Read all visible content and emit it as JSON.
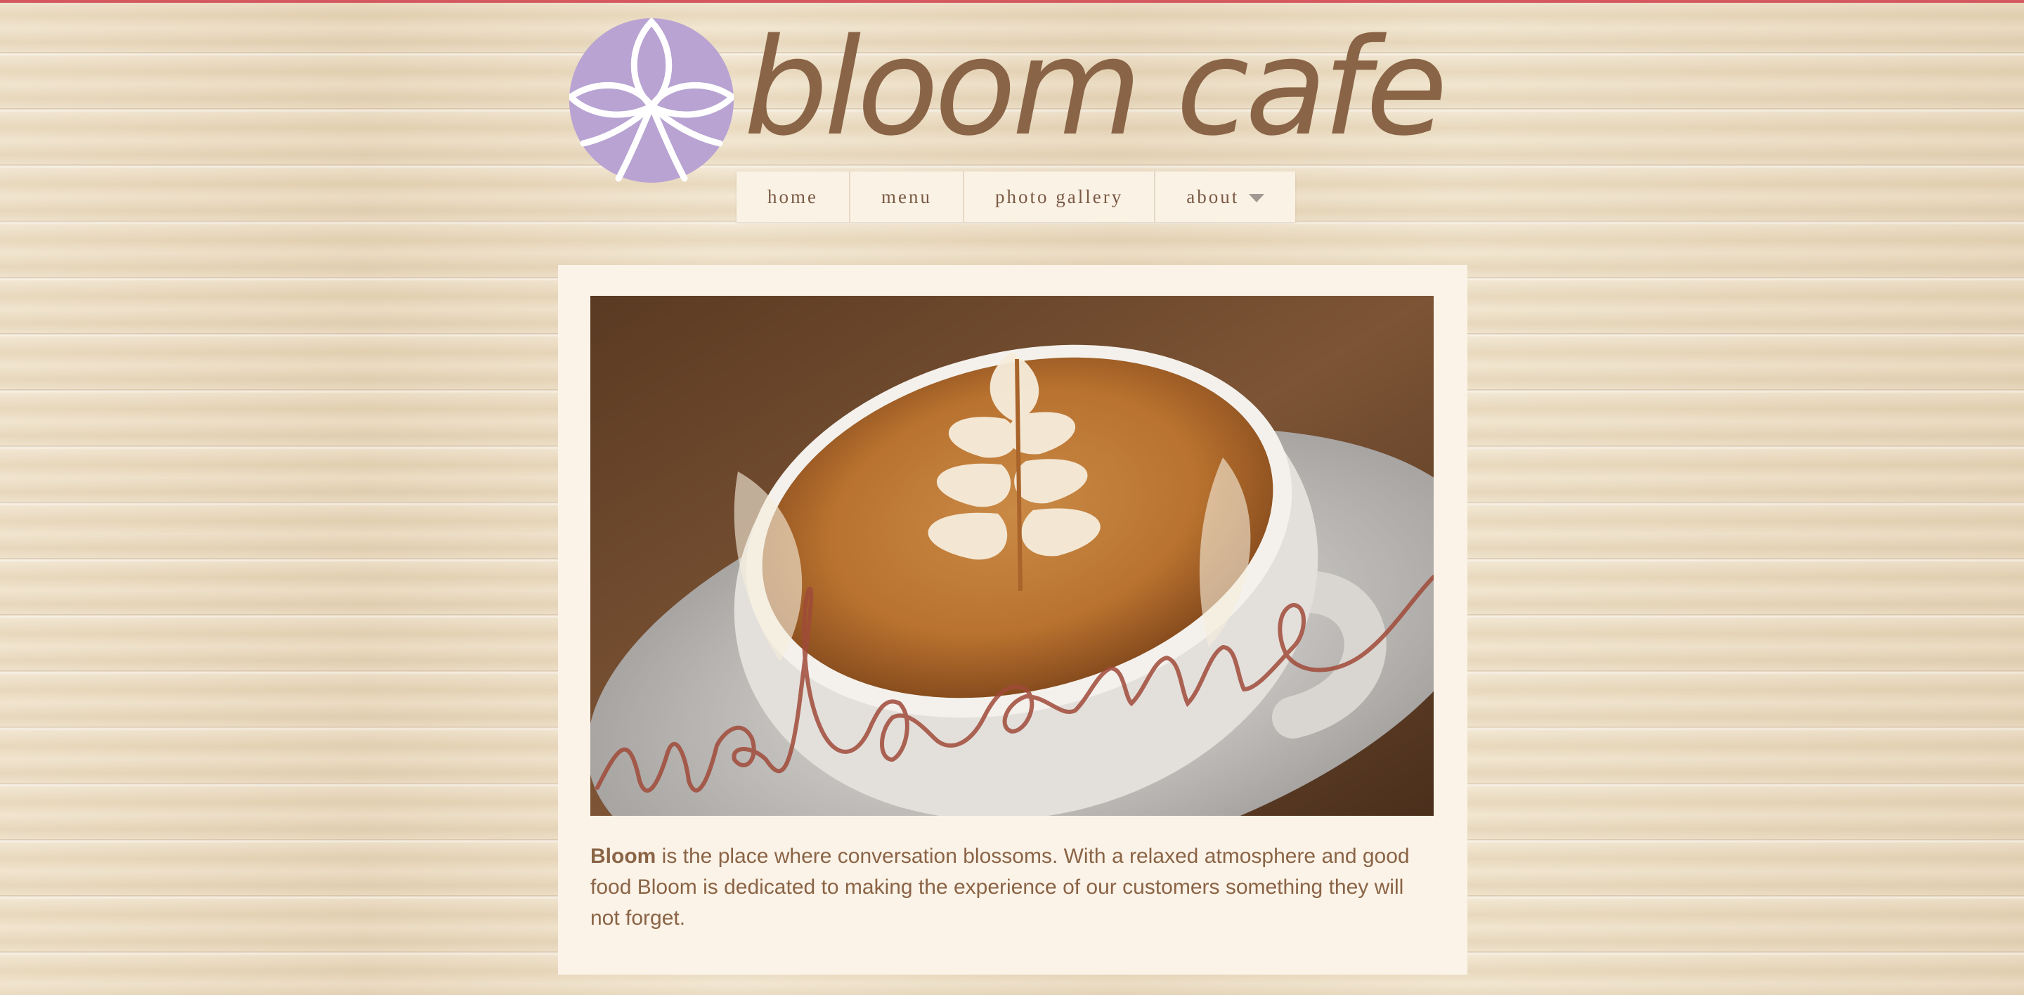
{
  "brand": {
    "name": "bloom cafe",
    "logo_icon": "lotus-flower-icon",
    "logo_color": "#b8a3d3",
    "text_color": "#8a6446"
  },
  "nav": {
    "items": [
      {
        "label": "home"
      },
      {
        "label": "menu"
      },
      {
        "label": "photo gallery"
      },
      {
        "label": "about",
        "has_dropdown": true,
        "dropdown_icon": "chevron-down-icon"
      }
    ]
  },
  "hero": {
    "image": "latte-art-coffee-cup-photo",
    "overlay_text": "welcome",
    "overlay_color": "#a04a38"
  },
  "intro": {
    "bold": "Bloom",
    "text": " is the place where conversation blossoms. With a relaxed atmosphere and good food Bloom is dedicated to making the experience of our customers something they will not forget."
  },
  "colors": {
    "accent_top_border": "#d4585f",
    "panel_background": "#fcf3e8"
  }
}
